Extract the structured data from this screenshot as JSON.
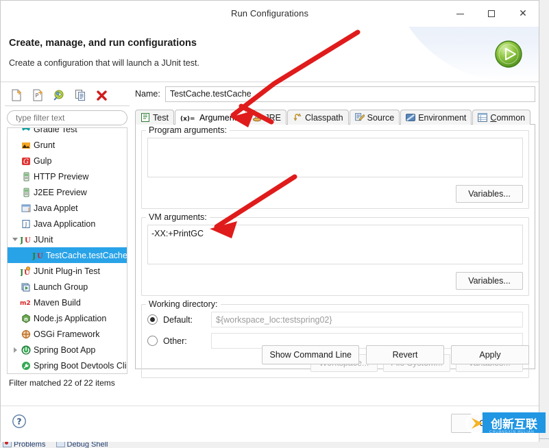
{
  "window": {
    "title": "Run Configurations",
    "minimize_label": "Minimize",
    "maximize_label": "Maximize",
    "close_label": "Close"
  },
  "banner": {
    "title": "Create, manage, and run configurations",
    "subtitle": "Create a configuration that will launch a JUnit test.",
    "run_icon": "run-play-icon"
  },
  "left": {
    "toolbar": [
      {
        "name": "new-launch-configuration",
        "icon": "new-document-icon"
      },
      {
        "name": "new-prototype",
        "icon": "new-prototype-icon"
      },
      {
        "name": "export-configuration",
        "icon": "export-run-icon"
      },
      {
        "name": "duplicate-configuration",
        "icon": "duplicate-icon"
      },
      {
        "name": "delete-configuration",
        "icon": "delete-x-icon"
      }
    ],
    "filter_placeholder": "type filter text",
    "filter_value": "",
    "tree": [
      {
        "label": "Gradle Test",
        "icon": "gradle-icon",
        "indent": 1,
        "twisty": "none",
        "selected": false,
        "clipped": true
      },
      {
        "label": "Grunt",
        "icon": "grunt-icon",
        "indent": 1,
        "twisty": "none",
        "selected": false
      },
      {
        "label": "Gulp",
        "icon": "gulp-icon",
        "indent": 1,
        "twisty": "none",
        "selected": false
      },
      {
        "label": "HTTP Preview",
        "icon": "server-icon",
        "indent": 1,
        "twisty": "none",
        "selected": false
      },
      {
        "label": "J2EE Preview",
        "icon": "server-icon",
        "indent": 1,
        "twisty": "none",
        "selected": false
      },
      {
        "label": "Java Applet",
        "icon": "java-applet-icon",
        "indent": 1,
        "twisty": "none",
        "selected": false
      },
      {
        "label": "Java Application",
        "icon": "java-application-icon",
        "indent": 1,
        "twisty": "none",
        "selected": false
      },
      {
        "label": "JUnit",
        "icon": "junit-icon",
        "indent": 0,
        "twisty": "expanded",
        "selected": false
      },
      {
        "label": "TestCache.testCache",
        "icon": "junit-icon",
        "indent": 2,
        "twisty": "none",
        "selected": true
      },
      {
        "label": "JUnit Plug-in Test",
        "icon": "junit-plugin-icon",
        "indent": 1,
        "twisty": "none",
        "selected": false
      },
      {
        "label": "Launch Group",
        "icon": "launch-group-icon",
        "indent": 1,
        "twisty": "none",
        "selected": false
      },
      {
        "label": "Maven Build",
        "icon": "maven-icon",
        "indent": 1,
        "twisty": "none",
        "selected": false
      },
      {
        "label": "Node.js Application",
        "icon": "nodejs-icon",
        "indent": 1,
        "twisty": "none",
        "selected": false
      },
      {
        "label": "OSGi Framework",
        "icon": "osgi-icon",
        "indent": 1,
        "twisty": "none",
        "selected": false
      },
      {
        "label": "Spring Boot App",
        "icon": "spring-boot-icon",
        "indent": 0,
        "twisty": "collapsed",
        "selected": false
      },
      {
        "label": "Spring Boot Devtools Cli",
        "icon": "spring-devtools-icon",
        "indent": 1,
        "twisty": "none",
        "selected": false
      }
    ],
    "filter_status": "Filter matched 22 of 22 items"
  },
  "right": {
    "name_label": "Name:",
    "name_value": "TestCache.testCache",
    "tabs": [
      {
        "label": "Test",
        "icon": "test-icon",
        "active": false,
        "mnemonic": ""
      },
      {
        "label": "Arguments",
        "icon": "arguments-icon",
        "active": true,
        "mnemonic": ""
      },
      {
        "label": "JRE",
        "icon": "jre-icon",
        "active": false,
        "mnemonic": ""
      },
      {
        "label": "Classpath",
        "icon": "classpath-icon",
        "active": false,
        "mnemonic": ""
      },
      {
        "label": "Source",
        "icon": "source-icon",
        "active": false,
        "mnemonic": ""
      },
      {
        "label": "Environment",
        "icon": "environment-icon",
        "active": false,
        "mnemonic": ""
      },
      {
        "label": "Common",
        "icon": "common-icon",
        "active": false,
        "mnemonic": "C"
      }
    ],
    "program_arguments": {
      "legend": "Program arguments:",
      "value": "",
      "variables_button": "Variables..."
    },
    "vm_arguments": {
      "legend": "VM arguments:",
      "value": "-XX:+PrintGC",
      "variables_button": "Variables..."
    },
    "working_directory": {
      "legend": "Working directory:",
      "default_label": "Default:",
      "default_selected": true,
      "default_value": "${workspace_loc:testspring02}",
      "other_label": "Other:",
      "other_selected": false,
      "other_value": "",
      "workspace_button": "Workspace...",
      "file_system_button": "File System...",
      "variables_button": "Variables..."
    },
    "apply_row": {
      "show_command_line": "Show Command Line",
      "revert": "Revert",
      "apply": "Apply"
    }
  },
  "footer": {
    "help_icon": "help-question-icon",
    "close_button": "Close"
  },
  "watermark": {
    "text": "创新互联",
    "subtext": "CHUANGXIN HULIAN"
  },
  "background_window": {
    "tabs": [
      {
        "label": "Problems",
        "icon": "problems-icon"
      },
      {
        "label": "Debug Shell",
        "icon": "debug-shell-icon"
      }
    ]
  },
  "annotations": {
    "color": "#e01b1b",
    "arrows": [
      {
        "name": "arrow-to-arguments-tab",
        "from": [
          522,
          47
        ],
        "to": [
          333,
          171
        ]
      },
      {
        "name": "arrow-to-vm-arguments",
        "from": [
          430,
          258
        ],
        "to": [
          303,
          334
        ]
      }
    ]
  }
}
